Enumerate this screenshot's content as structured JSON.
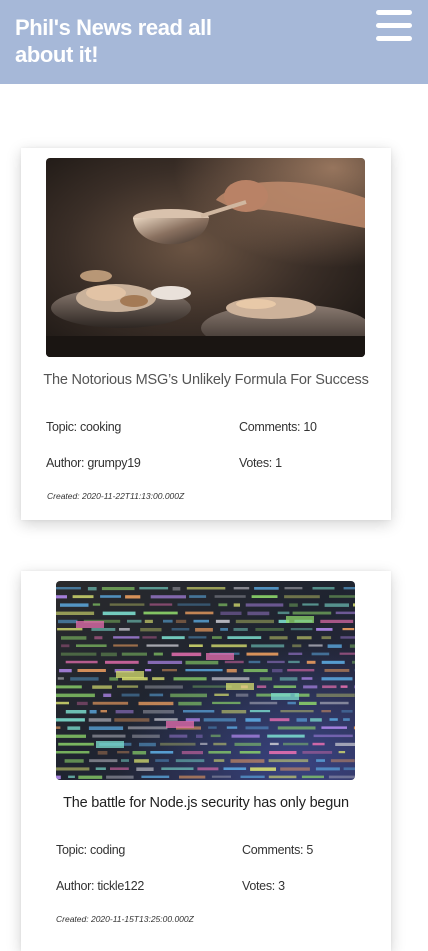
{
  "header": {
    "title": "Phil's News read all about it!",
    "background_color": "#a6b8d8",
    "menu_icon": "hamburger-menu-icon"
  },
  "articles": [
    {
      "image_description": "hands cooking with a metal pot over plated food in a dark kitchen",
      "title": "The Notorious MSG’s Unlikely Formula For Success",
      "topic": "Topic: cooking",
      "comments": "Comments: 10",
      "author": "Author: grumpy19",
      "votes": "Votes: 1",
      "created": "Created: 2020-11-22T11:13:00.000Z"
    },
    {
      "image_description": "close-up of a screen full of colorful source code",
      "title": "The battle for Node.js security has only begun",
      "topic": "Topic: coding",
      "comments": "Comments: 5",
      "author": "Author: tickle122",
      "votes": "Votes: 3",
      "created": "Created: 2020-11-15T13:25:00.000Z"
    }
  ]
}
